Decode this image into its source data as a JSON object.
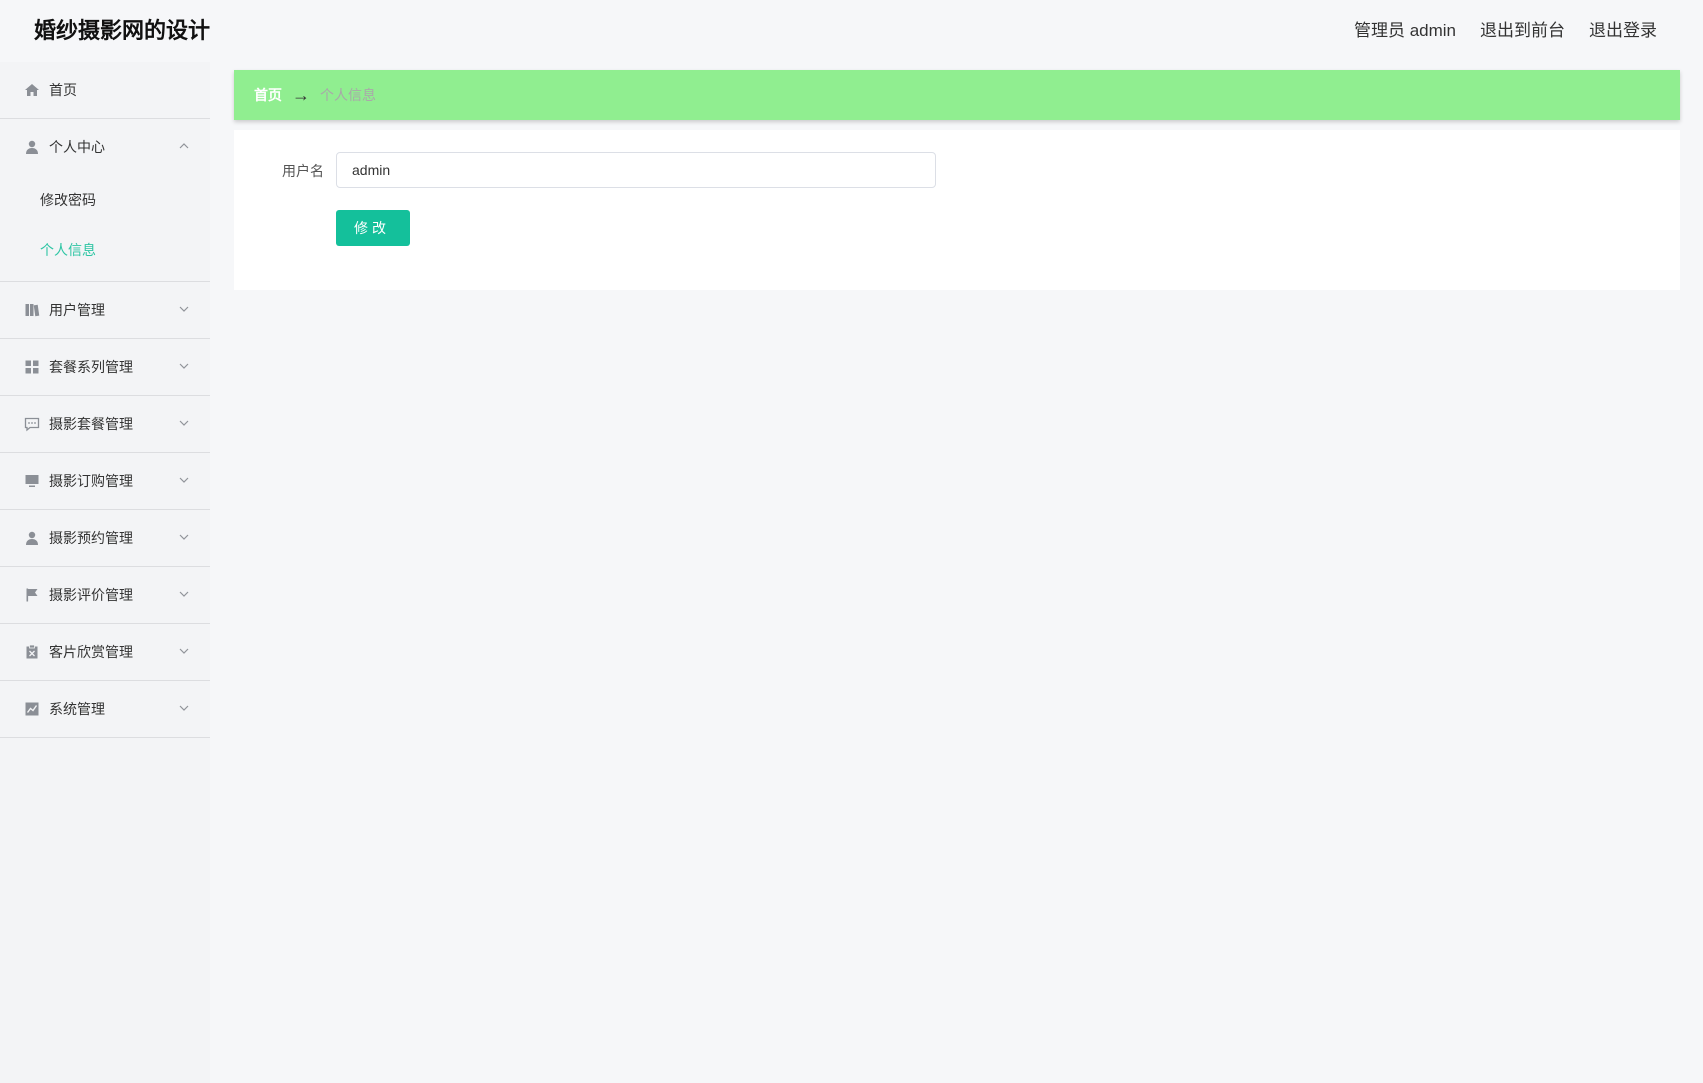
{
  "app": {
    "title": "婚纱摄影网的设计"
  },
  "header": {
    "user_label": "管理员 admin",
    "to_frontend": "退出到前台",
    "logout": "退出登录"
  },
  "sidebar": {
    "home": {
      "label": "首页",
      "icon": "home-icon"
    },
    "groups": [
      {
        "label": "个人中心",
        "icon": "user-icon",
        "expanded": true,
        "items": [
          {
            "label": "修改密码",
            "active": false
          },
          {
            "label": "个人信息",
            "active": true
          }
        ]
      },
      {
        "label": "用户管理",
        "icon": "book-icon",
        "expanded": false
      },
      {
        "label": "套餐系列管理",
        "icon": "grid-icon",
        "expanded": false
      },
      {
        "label": "摄影套餐管理",
        "icon": "chat-icon",
        "expanded": false
      },
      {
        "label": "摄影订购管理",
        "icon": "monitor-icon",
        "expanded": false
      },
      {
        "label": "摄影预约管理",
        "icon": "person-icon",
        "expanded": false
      },
      {
        "label": "摄影评价管理",
        "icon": "flag-icon",
        "expanded": false
      },
      {
        "label": "客片欣赏管理",
        "icon": "clipboard-icon",
        "expanded": false
      },
      {
        "label": "系统管理",
        "icon": "chart-icon",
        "expanded": false
      }
    ]
  },
  "breadcrumb": {
    "home": "首页",
    "separator": "→",
    "current": "个人信息"
  },
  "form": {
    "username_label": "用户名",
    "username_value": "admin",
    "submit_label": "修改"
  },
  "colors": {
    "accent": "#14c09b",
    "active_menu": "#2ec5a4",
    "breadcrumb_bg": "#90ee90"
  }
}
